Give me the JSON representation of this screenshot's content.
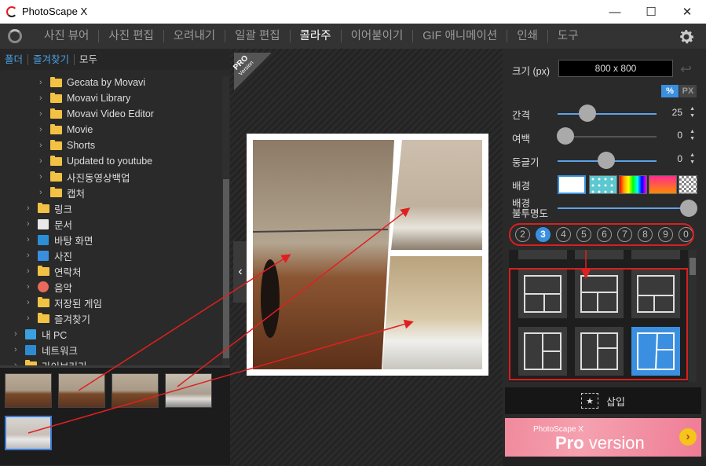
{
  "window": {
    "title": "PhotoScape X",
    "minimize": "—",
    "maximize": "☐",
    "close": "✕"
  },
  "menu": {
    "items": [
      "사진 뷰어",
      "사진 편집",
      "오려내기",
      "일괄 편집",
      "콜라주",
      "이어붙이기",
      "GIF 애니메이션",
      "인쇄",
      "도구"
    ],
    "active": "콜라주"
  },
  "left_tabs": [
    "폴더",
    "즐겨찾기",
    "모두"
  ],
  "tree": [
    {
      "label": "Gecata by Movavi",
      "icon": "folder"
    },
    {
      "label": "Movavi Library",
      "icon": "folder"
    },
    {
      "label": "Movavi Video Editor",
      "icon": "folder"
    },
    {
      "label": "Movie",
      "icon": "folder"
    },
    {
      "label": "Shorts",
      "icon": "folder"
    },
    {
      "label": "Updated to youtube",
      "icon": "folder"
    },
    {
      "label": "사진동영상백업",
      "icon": "folder"
    },
    {
      "label": "캡처",
      "icon": "folder"
    },
    {
      "label": "링크",
      "icon": "folder"
    },
    {
      "label": "문서",
      "icon": "document"
    },
    {
      "label": "바탕 화면",
      "icon": "desktop"
    },
    {
      "label": "사진",
      "icon": "pictures"
    },
    {
      "label": "연락처",
      "icon": "folder"
    },
    {
      "label": "음악",
      "icon": "music"
    },
    {
      "label": "저장된 게임",
      "icon": "folder"
    },
    {
      "label": "즐겨찾기",
      "icon": "folder"
    },
    {
      "label": "내 PC",
      "icon": "computer"
    },
    {
      "label": "네트워크",
      "icon": "network"
    },
    {
      "label": "라이브러리",
      "icon": "folder"
    }
  ],
  "pro_badge": {
    "line1": "PRO",
    "line2": "Version"
  },
  "right": {
    "size_label": "크기 (px)",
    "size_value": "800 x 800",
    "unit_pct": "%",
    "unit_px": "PX",
    "spacing_label": "간격",
    "spacing_value": "25",
    "margin_label": "여백",
    "margin_value": "0",
    "round_label": "둥글기",
    "round_value": "0",
    "bg_label": "배경",
    "bg_opacity_label1": "배경",
    "bg_opacity_label2": "불투명도",
    "counts": [
      "2",
      "3",
      "4",
      "5",
      "6",
      "7",
      "8",
      "9",
      "0"
    ],
    "active_count": "3",
    "insert_label": "삽입",
    "banner_brand": "PhotoScape X",
    "banner_pro": "Pro",
    "banner_version": " version",
    "banner_go": "›"
  },
  "colors": {
    "accent": "#3b8fe0",
    "annotation": "#d91f1f"
  }
}
